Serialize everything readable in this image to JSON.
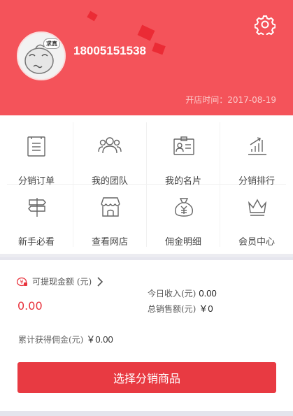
{
  "header": {
    "phone": "18005151538",
    "open_date": "开店时间：2017-08-19",
    "avatar_badge": "求真"
  },
  "menu": [
    {
      "label": "分销订单",
      "icon": "order-list-icon"
    },
    {
      "label": "我的团队",
      "icon": "team-icon"
    },
    {
      "label": "我的名片",
      "icon": "business-card-icon"
    },
    {
      "label": "分销排行",
      "icon": "ranking-chart-icon"
    },
    {
      "label": "新手必看",
      "icon": "signpost-icon"
    },
    {
      "label": "查看网店",
      "icon": "storefront-icon"
    },
    {
      "label": "佣金明细",
      "icon": "money-bag-icon"
    },
    {
      "label": "会员中心",
      "icon": "crown-icon"
    }
  ],
  "finance": {
    "withdrawable_label": "可提现金额 (元)",
    "withdrawable_amount": "0.00",
    "today_income_label": "今日收入(元)",
    "today_income_value": "0.00",
    "total_sales_label": "总销售额(元)",
    "total_sales_value": "￥0",
    "commission_label": "累计获得佣金(元)",
    "commission_value": "￥0.00"
  },
  "cta_label": "选择分销商品",
  "colors": {
    "header_bg": "#f4535a",
    "accent": "#e83a42"
  }
}
